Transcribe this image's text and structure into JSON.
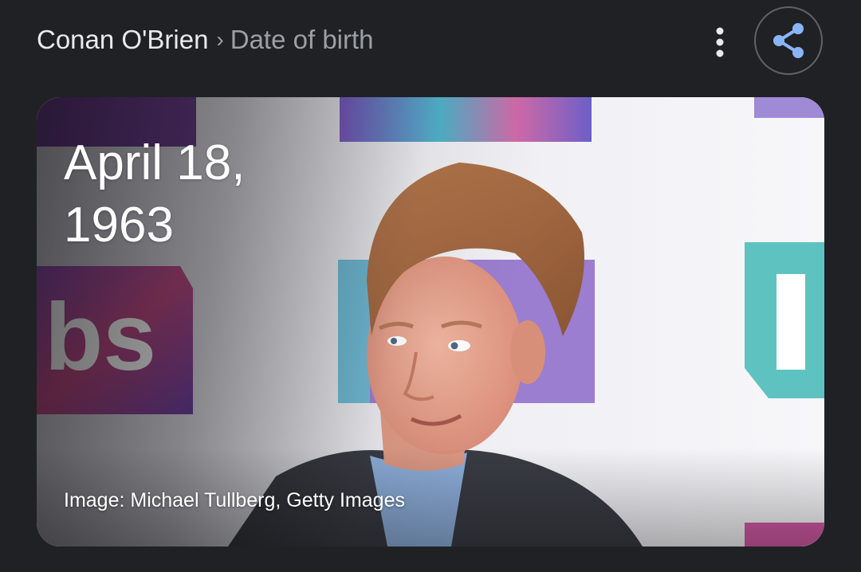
{
  "breadcrumb": {
    "entity": "Conan O'Brien",
    "separator": "›",
    "attribute": "Date of birth"
  },
  "actions": {
    "more_icon": "more-vert-icon",
    "share_icon": "share-icon",
    "share_icon_color": "#8ab4f8"
  },
  "card": {
    "value_line1": "April 18,",
    "value_line2": "1963",
    "image_credit": "Image: Michael Tullberg, Getty Images"
  },
  "colors": {
    "background": "#202124",
    "primary_text": "#e8eaed",
    "secondary_text": "#9aa0a6",
    "accent": "#8ab4f8"
  }
}
